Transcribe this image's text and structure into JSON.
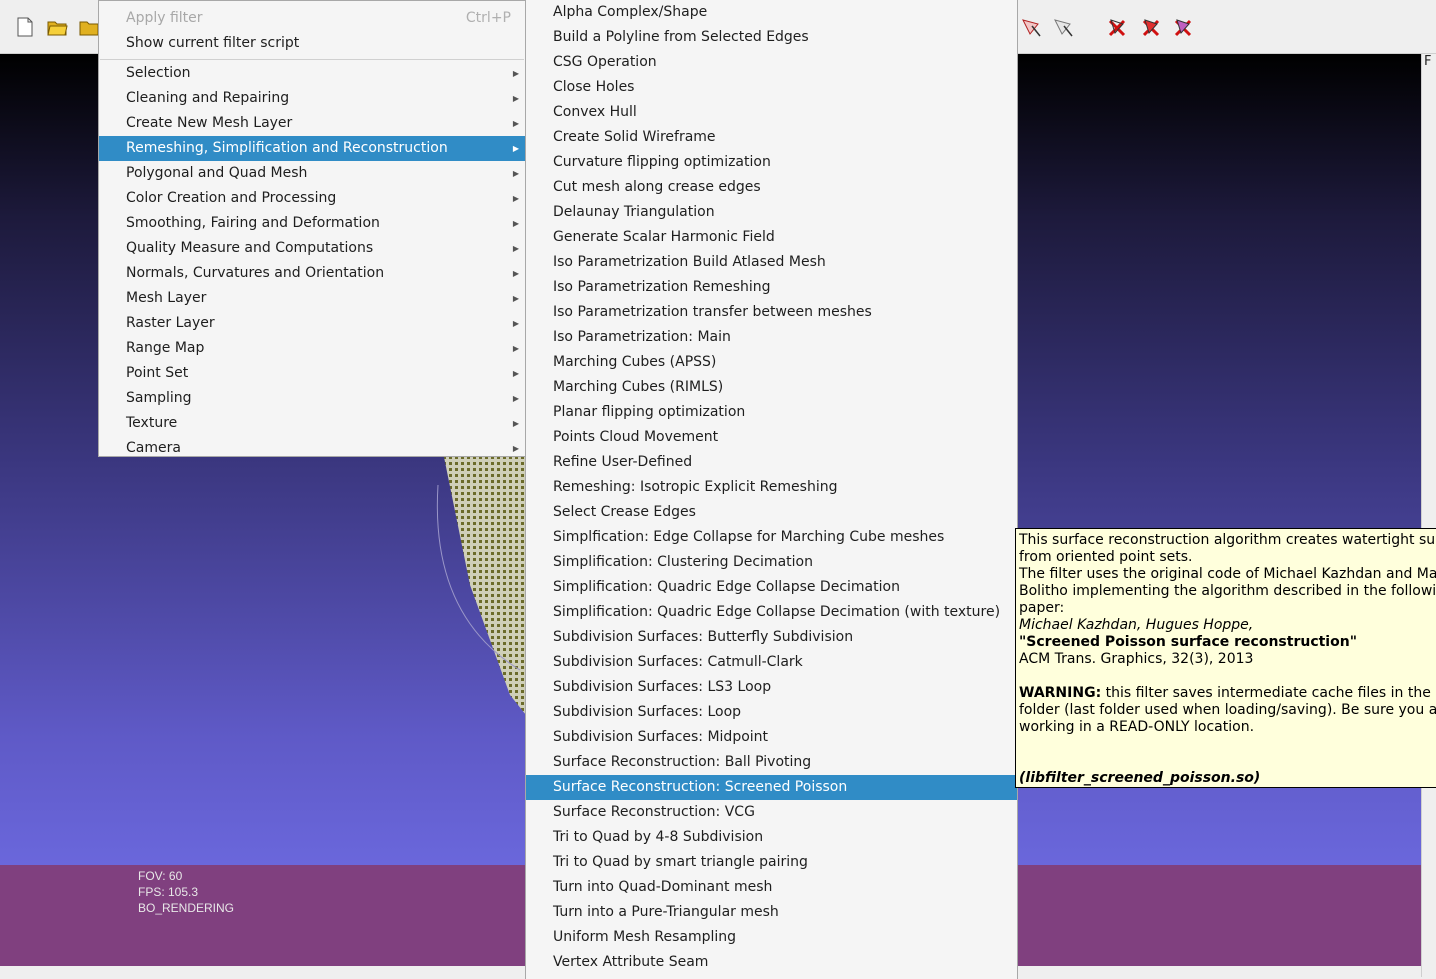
{
  "colors": {
    "highlight": "#308cc6",
    "viewport_bottom": "#80407f",
    "tooltip_bg": "#ffffdc"
  },
  "toolbar": {
    "icons": [
      "new-document-icon",
      "open-folder-icon",
      "open-project-icon",
      "select-faces-icon",
      "select-vertices-icon",
      "delete-selected-faces-icon",
      "delete-selected-vertices-icon",
      "delete-selected-icon"
    ]
  },
  "filters_menu": {
    "apply_filter": "Apply filter",
    "apply_filter_shortcut": "Ctrl+P",
    "show_script": "Show current filter script",
    "items": [
      "Selection",
      "Cleaning and Repairing",
      "Create New Mesh Layer",
      "Remeshing, Simplification and Reconstruction",
      "Polygonal and Quad Mesh",
      "Color Creation and Processing",
      "Smoothing, Fairing and Deformation",
      "Quality Measure and Computations",
      "Normals, Curvatures and Orientation",
      "Mesh Layer",
      "Raster Layer",
      "Range Map",
      "Point Set",
      "Sampling",
      "Texture",
      "Camera"
    ],
    "highlighted": "Remeshing, Simplification and Reconstruction"
  },
  "submenu": {
    "items": [
      "Alpha Complex/Shape",
      "Build a Polyline from Selected Edges",
      "CSG Operation",
      "Close Holes",
      "Convex Hull",
      "Create Solid Wireframe",
      "Curvature flipping optimization",
      "Cut mesh along crease edges",
      "Delaunay Triangulation",
      "Generate Scalar Harmonic Field",
      "Iso Parametrization Build Atlased Mesh",
      "Iso Parametrization Remeshing",
      "Iso Parametrization transfer between meshes",
      "Iso Parametrization: Main",
      "Marching Cubes (APSS)",
      "Marching Cubes (RIMLS)",
      "Planar flipping optimization",
      "Points Cloud Movement",
      "Refine User-Defined",
      "Remeshing: Isotropic Explicit Remeshing",
      "Select Crease Edges",
      "Simplfication: Edge Collapse for Marching Cube meshes",
      "Simplification: Clustering Decimation",
      "Simplification: Quadric Edge Collapse Decimation",
      "Simplification: Quadric Edge Collapse Decimation (with texture)",
      "Subdivision Surfaces: Butterfly Subdivision",
      "Subdivision Surfaces: Catmull-Clark",
      "Subdivision Surfaces: LS3 Loop",
      "Subdivision Surfaces: Loop",
      "Subdivision Surfaces: Midpoint",
      "Surface Reconstruction: Ball Pivoting",
      "Surface Reconstruction: Screened Poisson",
      "Surface Reconstruction: VCG",
      "Tri to Quad by 4-8 Subdivision",
      "Tri to Quad by smart triangle pairing",
      "Turn into Quad-Dominant mesh",
      "Turn into a Pure-Triangular mesh",
      "Uniform Mesh Resampling",
      "Vertex Attribute Seam"
    ],
    "highlighted": "Surface Reconstruction: Screened Poisson"
  },
  "tooltip": {
    "line1": "This surface reconstruction algorithm creates watertight surfa",
    "line2": "from oriented point sets.",
    "line3": "The filter uses the original code of Michael Kazhdan and Matt",
    "line4": "Bolitho implementing the algorithm described in the followin",
    "line5": "paper:",
    "authors": "Michael Kazhdan, Hugues Hoppe,",
    "paper_title": "\"Screened Poisson surface reconstruction\"",
    "journal": "ACM Trans. Graphics, 32(3), 2013",
    "warning_label": "WARNING:",
    "warning_text": " this filter saves intermediate cache files in the \"wo",
    "warning_line2": "folder (last folder used when loading/saving). Be sure you are",
    "warning_line3": "working in a READ-ONLY location.",
    "library": "(libfilter_screened_poisson.so)"
  },
  "viewport": {
    "fov": "FOV: 60",
    "fps": "FPS:   105.3",
    "mode": "BO_RENDERING"
  },
  "right_panel": {
    "corner_text": "F"
  }
}
